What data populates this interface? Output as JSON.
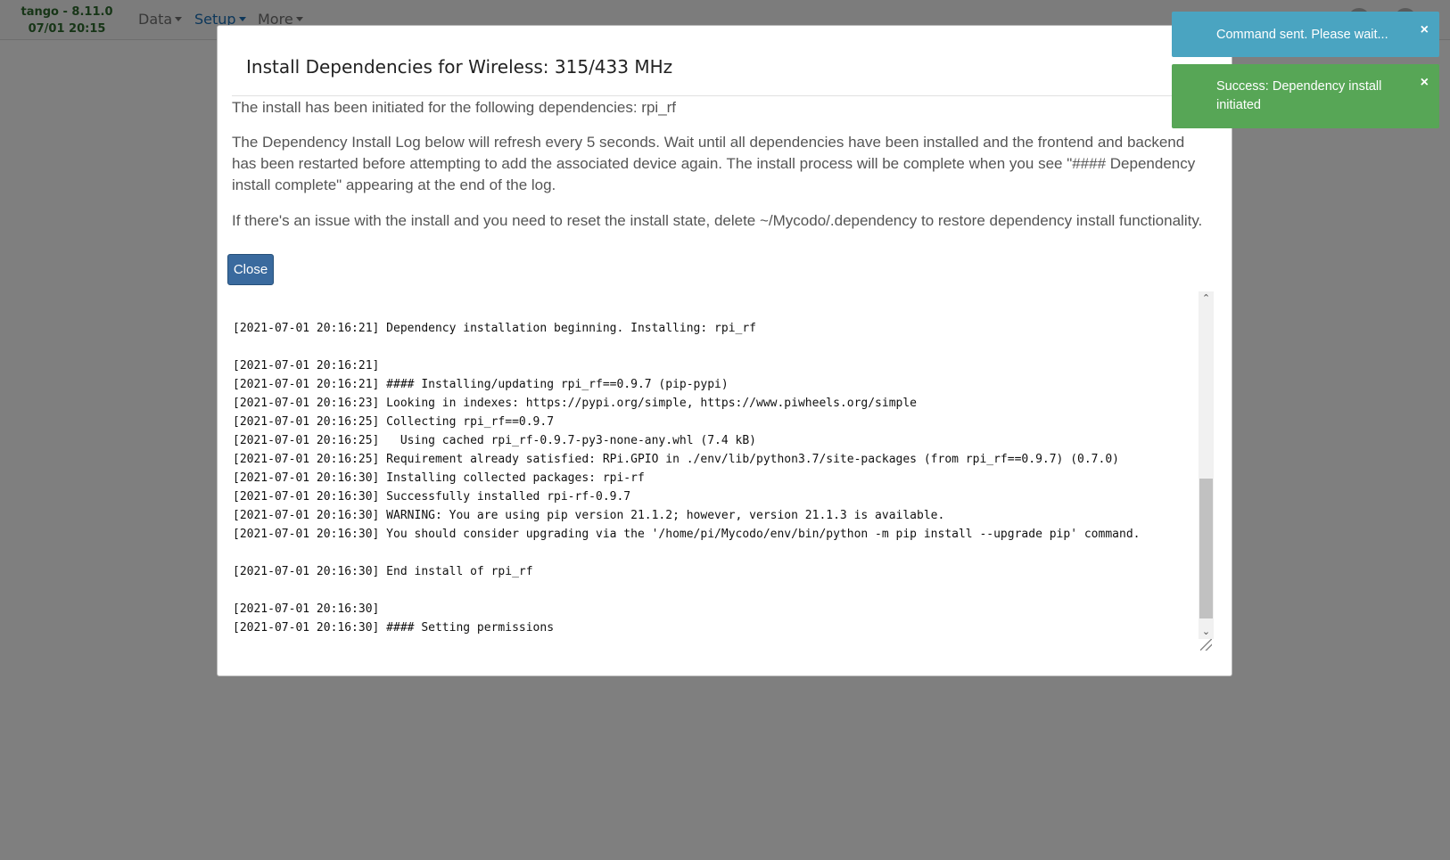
{
  "navbar": {
    "brand_line1": "tango - 8.11.0",
    "brand_line2": "07/01 20:15",
    "menu": [
      {
        "label": "Data"
      },
      {
        "label": "Setup"
      },
      {
        "label": "More"
      }
    ]
  },
  "modal": {
    "title": "Install Dependencies for Wireless: 315/433 MHz",
    "paragraphs": [
      "The install has been initiated for the following dependencies: rpi_rf",
      "The Dependency Install Log below will refresh every 5 seconds. Wait until all dependencies have been installed and the frontend and backend has been restarted before attempting to add the associated device again. The install process will be complete when you see \"#### Dependency install complete\" appearing at the end of the log.",
      "If there's an issue with the install and you need to reset the install state, delete ~/Mycodo/.dependency to restore dependency install functionality."
    ],
    "close_label": "Close",
    "log_lines": [
      "",
      "[2021-07-01 20:16:21] Dependency installation beginning. Installing: rpi_rf",
      "",
      "[2021-07-01 20:16:21]",
      "[2021-07-01 20:16:21] #### Installing/updating rpi_rf==0.9.7 (pip-pypi)",
      "[2021-07-01 20:16:23] Looking in indexes: https://pypi.org/simple, https://www.piwheels.org/simple",
      "[2021-07-01 20:16:25] Collecting rpi_rf==0.9.7",
      "[2021-07-01 20:16:25]   Using cached rpi_rf-0.9.7-py3-none-any.whl (7.4 kB)",
      "[2021-07-01 20:16:25] Requirement already satisfied: RPi.GPIO in ./env/lib/python3.7/site-packages (from rpi_rf==0.9.7) (0.7.0)",
      "[2021-07-01 20:16:30] Installing collected packages: rpi-rf",
      "[2021-07-01 20:16:30] Successfully installed rpi-rf-0.9.7",
      "[2021-07-01 20:16:30] WARNING: You are using pip version 21.1.2; however, version 21.1.3 is available.",
      "[2021-07-01 20:16:30] You should consider upgrading via the '/home/pi/Mycodo/env/bin/python -m pip install --upgrade pip' command.",
      "",
      "[2021-07-01 20:16:30] End install of rpi_rf",
      "",
      "[2021-07-01 20:16:30]",
      "[2021-07-01 20:16:30] #### Setting permissions"
    ]
  },
  "toasts": [
    {
      "type": "info",
      "message": "Command sent. Please wait...",
      "close": "×"
    },
    {
      "type": "success",
      "message": "Success: Dependency install initiated",
      "close": "×"
    }
  ],
  "scroll": {
    "position_fraction": 0.54,
    "up_arrow": "⌃",
    "down_arrow": "⌄"
  },
  "colors": {
    "info": "#4aa4c1",
    "success": "#57a656",
    "primary_button": "#3a6a9e",
    "brand": "#2f6b2f",
    "active_nav": "#1a6eb5"
  }
}
